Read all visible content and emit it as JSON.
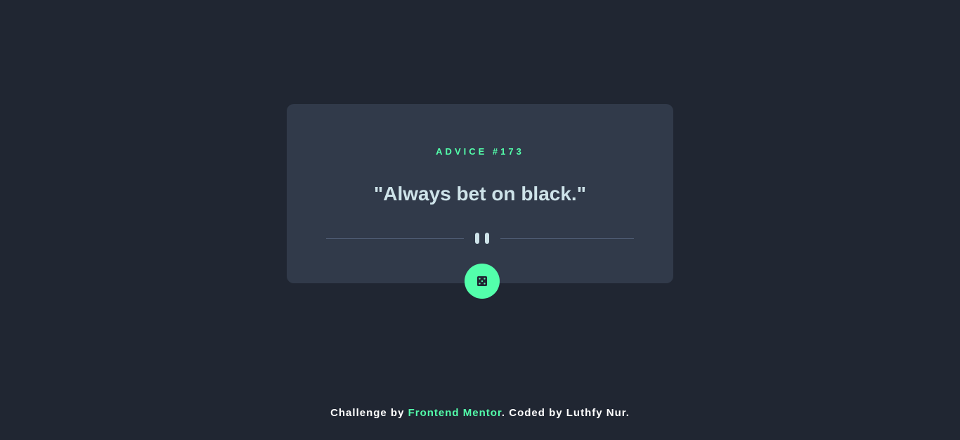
{
  "card": {
    "advice_label": "ADVICE #173",
    "quote": "\"Always bet on black.\""
  },
  "divider": {
    "icon": "pause-icon"
  },
  "dice_button": {
    "icon": "dice-icon"
  },
  "footer": {
    "prefix": "Challenge by ",
    "link1": "Frontend Mentor",
    "middle": ". Coded by ",
    "link2": "Luthfy Nur",
    "suffix": "."
  },
  "colors": {
    "background": "#202632",
    "card": "#313a4a",
    "accent": "#53ffab",
    "quote_text": "#cee3e9",
    "divider": "#4f5d74"
  }
}
